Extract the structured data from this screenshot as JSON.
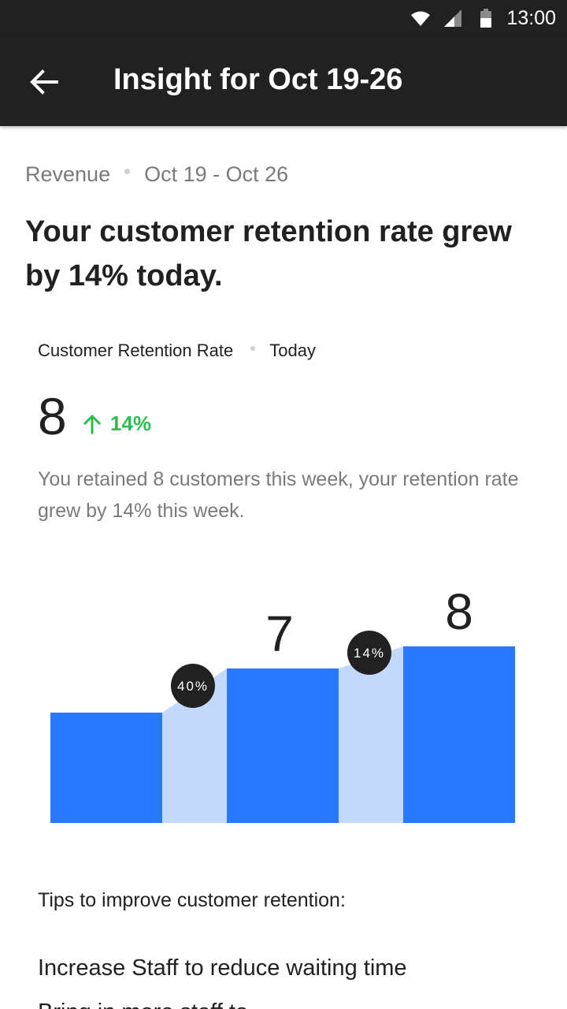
{
  "status_bar": {
    "time": "13:00",
    "icons": [
      "wifi-icon",
      "cell-signal-icon",
      "battery-icon"
    ]
  },
  "app_bar": {
    "back_icon": "arrow-left-icon",
    "title": "Insight for Oct 19-26"
  },
  "insight": {
    "category": "Revenue",
    "date_range": "Oct 19 - Oct 26",
    "headline": "Your customer retention rate grew by 14% today."
  },
  "metric": {
    "name": "Customer Retention Rate",
    "period": "Today",
    "value": "8",
    "change": "14%",
    "change_icon": "arrow-up-icon",
    "description": "You retained 8 customers this week, your retention rate grew by 14% this week."
  },
  "chart_data": {
    "type": "bar",
    "values": [
      5,
      7,
      8
    ],
    "value_labels": [
      "",
      "7",
      "8"
    ],
    "growth_labels": [
      "40%",
      "14%"
    ],
    "colors": {
      "bar": "#2979ff",
      "connector": "#c2d9fc",
      "badge": "#212121"
    }
  },
  "tips": {
    "title": "Tips to improve customer retention:",
    "items": [
      "Increase Staff to reduce waiting time",
      "Bring in more staff to..."
    ]
  },
  "colors": {
    "app_bar": "#212121",
    "positive": "#2dbd4e",
    "secondary_text": "#7a7a7a"
  }
}
